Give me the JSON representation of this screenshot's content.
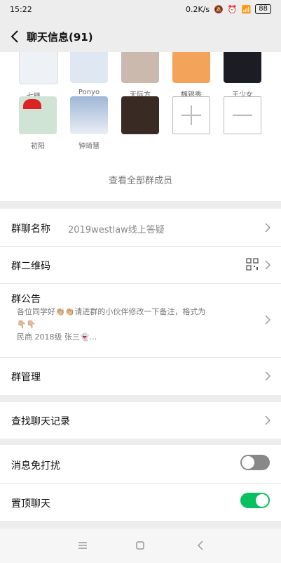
{
  "status_bar": {
    "time": "15:22",
    "speed": "0.2K/s",
    "battery": "88"
  },
  "header": {
    "title": "聊天信息(91)"
  },
  "members": {
    "top_row": [
      {
        "name": "七様 ..."
      },
      {
        "name": "Ponyo"
      },
      {
        "name": "天际方"
      },
      {
        "name": "魏银秀"
      },
      {
        "name": "王少女"
      }
    ],
    "second_row": [
      {
        "name": "初阳"
      },
      {
        "name": "钟琦慧"
      },
      {
        "name": ""
      }
    ],
    "view_all": "查看全部群成员"
  },
  "settings": {
    "group_name_label": "群聊名称",
    "group_name_value": "2019westlaw线上答疑",
    "qr_label": "群二维码",
    "notice_label": "群公告",
    "notice_text_1": "各位同学好👏🏼👏🏼请进群的小伙伴修改一下备注，格式为",
    "notice_text_2": "👇🏼👇🏼",
    "notice_text_3": "民商 2018级 张三👻...",
    "manage_label": "群管理",
    "search_label": "查找聊天记录",
    "mute_label": "消息免打扰",
    "mute_on": false,
    "pin_label": "置顶聊天",
    "pin_on": true
  },
  "colors": {
    "accent": "#07c160",
    "toggle_off": "#888888"
  }
}
